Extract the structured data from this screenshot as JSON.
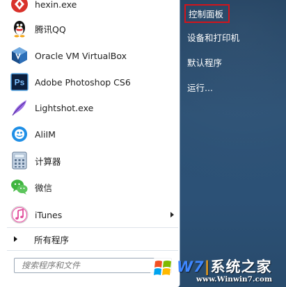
{
  "programs": [
    {
      "label": "hexin.exe",
      "icon": "hexin-icon"
    },
    {
      "label": "腾讯QQ",
      "icon": "qq-penguin-icon"
    },
    {
      "label": "Oracle VM VirtualBox",
      "icon": "virtualbox-icon"
    },
    {
      "label": "Adobe Photoshop CS6",
      "icon": "photoshop-icon"
    },
    {
      "label": "Lightshot.exe",
      "icon": "lightshot-feather-icon"
    },
    {
      "label": "AliIM",
      "icon": "aliim-icon"
    },
    {
      "label": "计算器",
      "icon": "calculator-icon"
    },
    {
      "label": "微信",
      "icon": "wechat-icon"
    },
    {
      "label": "iTunes",
      "icon": "itunes-icon",
      "has_submenu": true
    }
  ],
  "ps_letters": "Ps",
  "all_programs_label": "所有程序",
  "search": {
    "placeholder": "搜索程序和文件"
  },
  "right_items": [
    {
      "label": "控制面板",
      "highlighted": true
    },
    {
      "label": "设备和打印机"
    },
    {
      "label": "默认程序"
    },
    {
      "label": "运行..."
    }
  ],
  "watermark": {
    "w": "W",
    "seven": "7",
    "sep": "|",
    "name": "系统之家",
    "url": "www.Winwin7.com"
  },
  "colors": {
    "highlight_border": "#d3141b",
    "right_panel": "#2b5074"
  }
}
